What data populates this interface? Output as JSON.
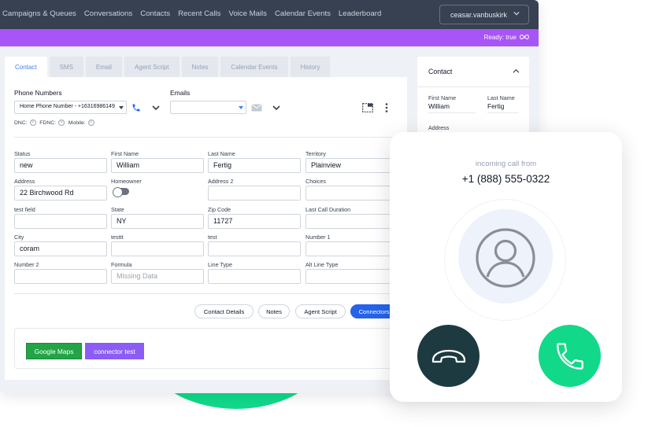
{
  "nav": [
    "Campaigns & Queues",
    "Conversations",
    "Contacts",
    "Recent Calls",
    "Voice Mails",
    "Calendar Events",
    "Leaderboard"
  ],
  "user": "ceasar.vanbuskirk",
  "status": "Ready: true",
  "tabs": [
    "Contact",
    "SMS",
    "Email",
    "Agent Script",
    "Notes",
    "Calendar Events",
    "History"
  ],
  "phone": {
    "label": "Phone Numbers",
    "value": "Home Phone Number - +16316986149",
    "flags": [
      "DNC:",
      "FDNC:",
      "Mobile:"
    ]
  },
  "emails": {
    "label": "Emails"
  },
  "fields": [
    {
      "label": "Status",
      "value": "new"
    },
    {
      "label": "First Name",
      "value": "William"
    },
    {
      "label": "Last Name",
      "value": "Fertig"
    },
    {
      "label": "Territory",
      "value": "Plainview"
    },
    {
      "label": "Address",
      "value": "22  Birchwood Rd"
    },
    {
      "label": "Homeowner",
      "value": ""
    },
    {
      "label": "Address 2",
      "value": ""
    },
    {
      "label": "Choices",
      "value": ""
    },
    {
      "label": "test field",
      "value": ""
    },
    {
      "label": "State",
      "value": "NY"
    },
    {
      "label": "Zip Code",
      "value": "11727"
    },
    {
      "label": "Last Call Duration",
      "value": ""
    },
    {
      "label": "City",
      "value": "coram"
    },
    {
      "label": "testtt",
      "value": ""
    },
    {
      "label": "test",
      "value": ""
    },
    {
      "label": "Number 1",
      "value": ""
    },
    {
      "label": "Number 2",
      "value": ""
    },
    {
      "label": "Formula",
      "value": "Missing Data"
    },
    {
      "label": "Line Type",
      "value": ""
    },
    {
      "label": "Alt Line Type",
      "value": ""
    }
  ],
  "actions": [
    "Contact Details",
    "Notes",
    "Agent Script",
    "Connectors"
  ],
  "connectors": [
    "Google Maps",
    "connector test"
  ],
  "side": {
    "title": "Contact",
    "first_label": "First Name",
    "first_value": "William",
    "last_label": "Last Name",
    "last_value": "Fertig",
    "address_label": "Address"
  },
  "call": {
    "from": "incoming call from",
    "number": "+1 (888) 555-0322"
  },
  "colors": {
    "topbar": "#374151",
    "purple": "#a855f7",
    "accent": "#3b82f6",
    "accept": "#12d98a",
    "decline": "#1e3a41"
  }
}
